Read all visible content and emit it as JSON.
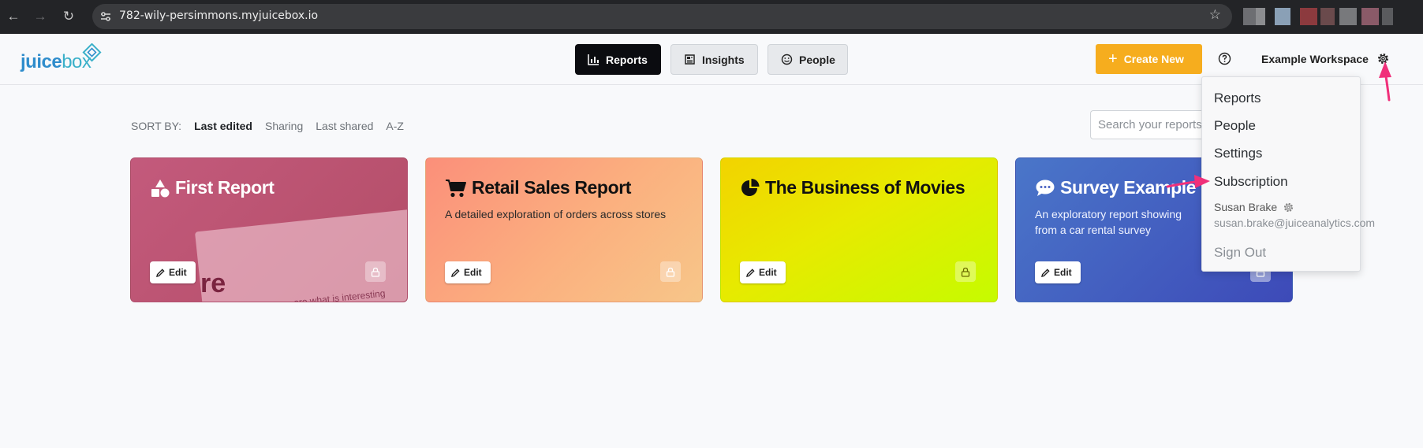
{
  "browser": {
    "url": "782-wily-persimmons.myjuicebox.io"
  },
  "header": {
    "logo": {
      "part1": "juice",
      "part2": "box"
    },
    "tabs": [
      {
        "label": "Reports",
        "active": true
      },
      {
        "label": "Insights",
        "active": false
      },
      {
        "label": "People",
        "active": false
      }
    ],
    "create_label": "Create New",
    "workspace_label": "Example Workspace"
  },
  "sort": {
    "label": "SORT BY:",
    "options": [
      "Last edited",
      "Sharing",
      "Last shared",
      "A-Z"
    ],
    "active": "Last edited"
  },
  "search": {
    "placeholder": "Search your reports"
  },
  "cards": [
    {
      "title": "First Report",
      "description": "",
      "icon": "shapes-icon",
      "edit_label": "Edit",
      "preview_big": "re",
      "preview_small": "...ore what is interesting"
    },
    {
      "title": "Retail Sales Report",
      "description": "A detailed exploration of orders across stores",
      "icon": "cart-icon",
      "edit_label": "Edit"
    },
    {
      "title": "The Business of Movies",
      "description": "",
      "icon": "pie-chart-icon",
      "edit_label": "Edit"
    },
    {
      "title": "Survey Example",
      "description": "An exploratory report showing from a car rental survey",
      "icon": "chat-icon",
      "edit_label": "Edit"
    }
  ],
  "dropdown": {
    "items": [
      "Reports",
      "People",
      "Settings",
      "Subscription"
    ],
    "user_name": "Susan Brake",
    "user_email": "susan.brake@juiceanalytics.com",
    "sign_out": "Sign Out"
  },
  "colors": {
    "accent": "#f6ad1e",
    "annotation": "#f0307a",
    "brand_blue": "#2f8dcc"
  }
}
